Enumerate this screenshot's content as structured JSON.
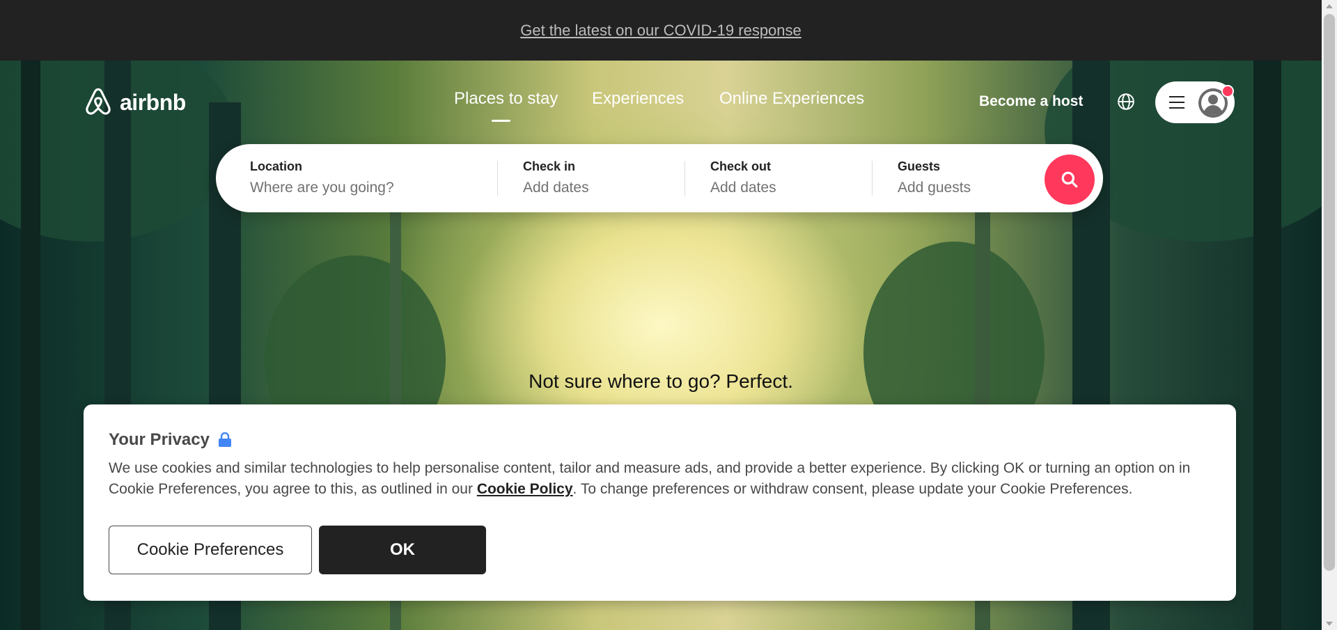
{
  "banner": {
    "link_text": "Get the latest on our COVID-19 response"
  },
  "header": {
    "brand": "airbnb",
    "nav": [
      {
        "label": "Places to stay",
        "active": true
      },
      {
        "label": "Experiences",
        "active": false
      },
      {
        "label": "Online Experiences",
        "active": false
      }
    ],
    "become_host": "Become a host",
    "icons": {
      "logo": "airbnb-belo-icon",
      "language": "globe-icon",
      "menu": "hamburger-icon",
      "profile": "avatar-icon",
      "notification": "notification-dot"
    }
  },
  "search": {
    "location": {
      "label": "Location",
      "placeholder": "Where are you going?"
    },
    "check_in": {
      "label": "Check in",
      "placeholder": "Add dates"
    },
    "check_out": {
      "label": "Check out",
      "placeholder": "Add dates"
    },
    "guests": {
      "label": "Guests",
      "placeholder": "Add guests"
    },
    "button_icon": "search-icon"
  },
  "hero": {
    "tagline": "Not sure where to go? Perfect."
  },
  "privacy": {
    "title": "Your Privacy",
    "title_icon": "lock-icon",
    "text_before": "We use cookies and similar technologies to help personalise content, tailor and measure ads, and provide a better experience. By clicking OK or turning an option on in Cookie Preferences, you agree to this, as outlined in our ",
    "link": "Cookie Policy",
    "text_after": ". To change preferences or withdraw consent, please update your Cookie Preferences.",
    "preferences_button": "Cookie Preferences",
    "ok_button": "OK"
  },
  "colors": {
    "brand": "#ff385c",
    "banner_bg": "#222222",
    "lock": "#4285f4"
  }
}
